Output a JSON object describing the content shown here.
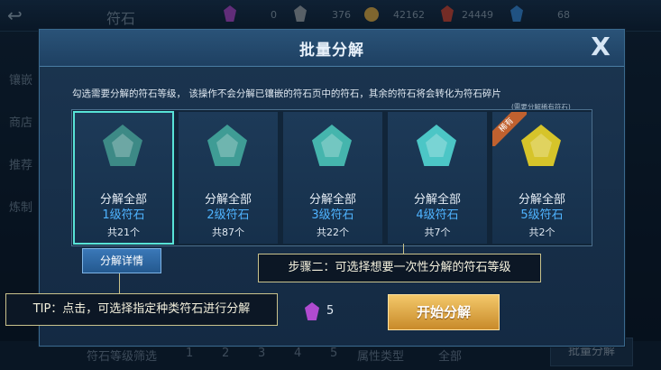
{
  "topbar": {
    "title": "符石",
    "resources": [
      {
        "icon": "purple-gem-icon",
        "value": "0"
      },
      {
        "icon": "silver-stone-icon",
        "value": "376"
      },
      {
        "icon": "gold-coin-icon",
        "value": "42162"
      },
      {
        "icon": "red-crystal-icon",
        "value": "24449"
      },
      {
        "icon": "diamond-icon",
        "value": "68"
      }
    ]
  },
  "sidebar": {
    "items": [
      "镶嵌",
      "商店",
      "推荐",
      "炼制"
    ]
  },
  "right_labels": [
    "荐推",
    "选择"
  ],
  "bottombar": {
    "filter_label": "符石等级筛选",
    "levels": [
      "1",
      "2",
      "3",
      "4",
      "5"
    ],
    "attr_label": "属性类型",
    "all_label": "全部",
    "decompose_button": "批量分解"
  },
  "modal": {
    "title": "批量分解",
    "close_label": "X",
    "instruction": "勾选需要分解的符石等级， 该操作不会分解已镶嵌的符石页中的符石，其余的符石将会转化为符石碎片",
    "hint": "(需要分解稀有符石)",
    "cards": [
      {
        "action": "分解全部",
        "level": "1级符石",
        "count": "共21个",
        "color": "#3d8a86",
        "selected": true
      },
      {
        "action": "分解全部",
        "level": "2级符石",
        "count": "共87个",
        "color": "#3f9c95",
        "selected": false
      },
      {
        "action": "分解全部",
        "level": "3级符石",
        "count": "共22个",
        "color": "#45b5ad",
        "selected": false
      },
      {
        "action": "分解全部",
        "level": "4级符石",
        "count": "共7个",
        "color": "#4cc6c6",
        "selected": false
      },
      {
        "action": "分解全部",
        "level": "5级符石",
        "count": "共2个",
        "color": "#d6c42a",
        "selected": false,
        "badge": "稀有"
      }
    ],
    "detail_button": "分解详情",
    "step_text": "步骤二：可选择想要一次性分解的符石等级",
    "tip_text": "TIP：点击，可选择指定种类符石进行分解",
    "cost_value": "5",
    "start_button": "开始分解"
  }
}
